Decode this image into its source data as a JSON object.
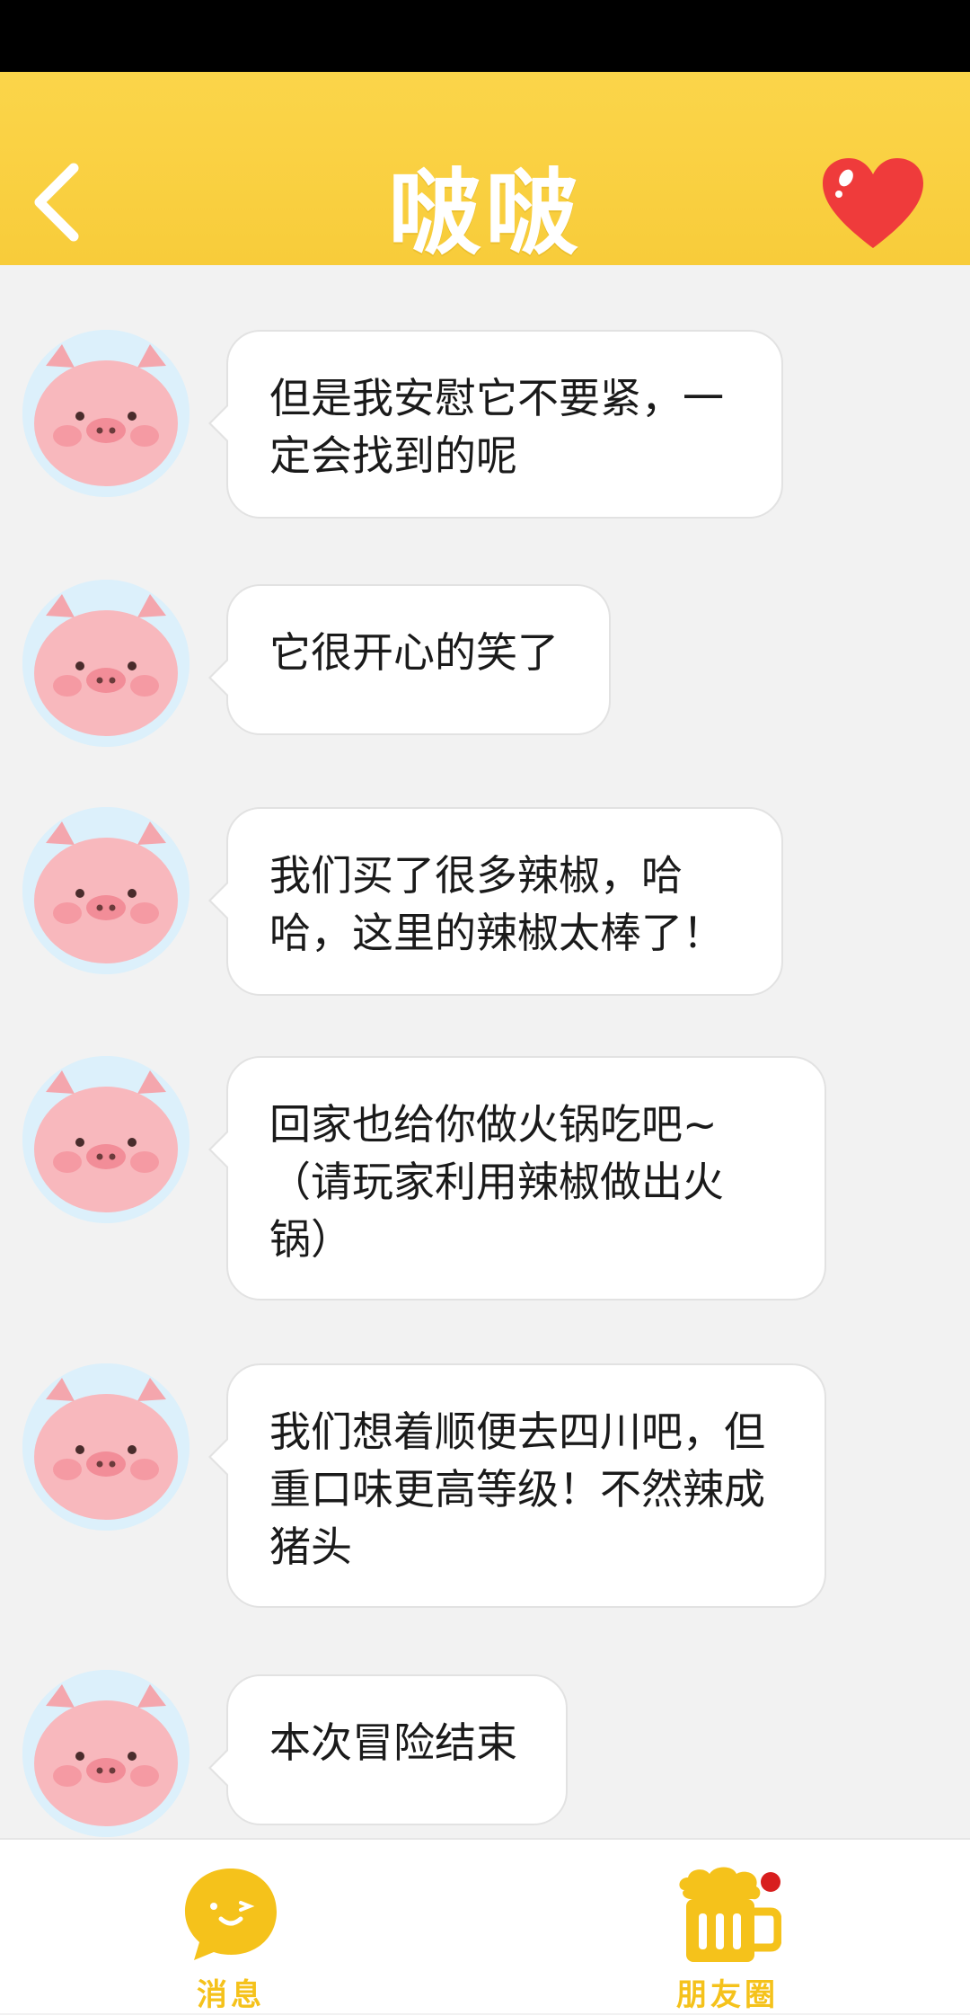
{
  "header": {
    "title": "啵啵",
    "back_icon": "chevron-left-icon",
    "favorite_icon": "heart-icon"
  },
  "messages": [
    {
      "text": "但是我安慰它不要紧，一定会找到的呢"
    },
    {
      "text": "它很开心的笑了"
    },
    {
      "text": "我们买了很多辣椒，哈哈，这里的辣椒太棒了！"
    },
    {
      "text": "回家也给你做火锅吃吧~（请玩家利用辣椒做出火锅）"
    },
    {
      "text": "我们想着顺便去四川吧，但重口味更高等级！不然辣成猪头"
    },
    {
      "text": "本次冒险结束"
    }
  ],
  "tabs": {
    "messages_label": "消息",
    "moments_label": "朋友圈"
  },
  "colors": {
    "header": "#f8cc3a",
    "accent": "#f5c21b",
    "heart": "#ef3b3b",
    "badge": "#d81e1e"
  }
}
